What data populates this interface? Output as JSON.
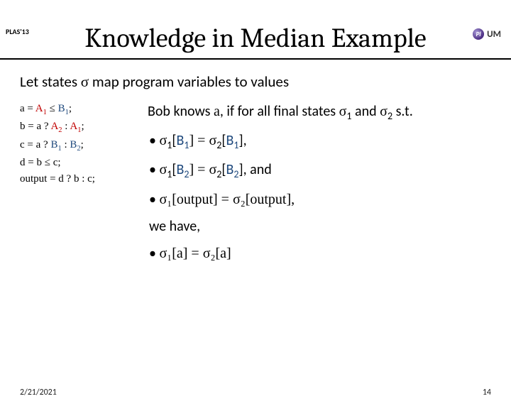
{
  "header": {
    "tag": "PLAS'13",
    "logo_initials": "Pl",
    "logo_text": "UM"
  },
  "title": "Knowledge in Median Example",
  "intro_pre": "Let states ",
  "intro_sigma": "σ",
  "intro_post": " map program variables to values",
  "code": {
    "l1_pre": "a = ",
    "l1_A": "A",
    "l1_A_sub": "1",
    "l1_mid": " ≤ ",
    "l1_B": "B",
    "l1_B_sub": "1",
    "l1_end": ";",
    "l2_pre": "b = a ? ",
    "l2_A": "A",
    "l2_A_sub": "2",
    "l2_mid": " : ",
    "l2_A2": "A",
    "l2_A2_sub": "1",
    "l2_end": ";",
    "l3_pre": "c = a ? ",
    "l3_B": "B",
    "l3_B_sub": "1",
    "l3_mid": " : ",
    "l3_B2": "B",
    "l3_B2_sub": "2",
    "l3_end": ";",
    "l4": "d = b ≤ c;",
    "l5": "output = d ? b : c;"
  },
  "right": {
    "bob_pre": "Bob knows ",
    "bob_a": "a",
    "bob_mid": ", if for all final states ",
    "bob_s1": "σ",
    "bob_1": "1",
    "bob_and": " and ",
    "bob_s2": "σ",
    "bob_2": "2",
    "bob_end": " s.t.",
    "b1_pre": "σ",
    "b1_sub1": "1",
    "b1_open": "[",
    "b1_B": "B",
    "b1_Bsub": "1",
    "b1_close": "] = σ",
    "b1_sub2": "2",
    "b1_open2": "[",
    "b1_B2": "B",
    "b1_B2sub": "1",
    "b1_close2": "],",
    "b2_pre": "σ",
    "b2_sub1": "1",
    "b2_open": "[",
    "b2_B": "B",
    "b2_Bsub": "2",
    "b2_close": "] = σ",
    "b2_sub2": "2",
    "b2_open2": "[",
    "b2_B2": "B",
    "b2_B2sub": "2",
    "b2_close2": "], and",
    "b3": "σ₁[output] = σ₂[output],",
    "wehave": "we have,",
    "b4": "σ₁[a] = σ₂[a]"
  },
  "footer": {
    "date": "2/21/2021",
    "page": "14"
  }
}
